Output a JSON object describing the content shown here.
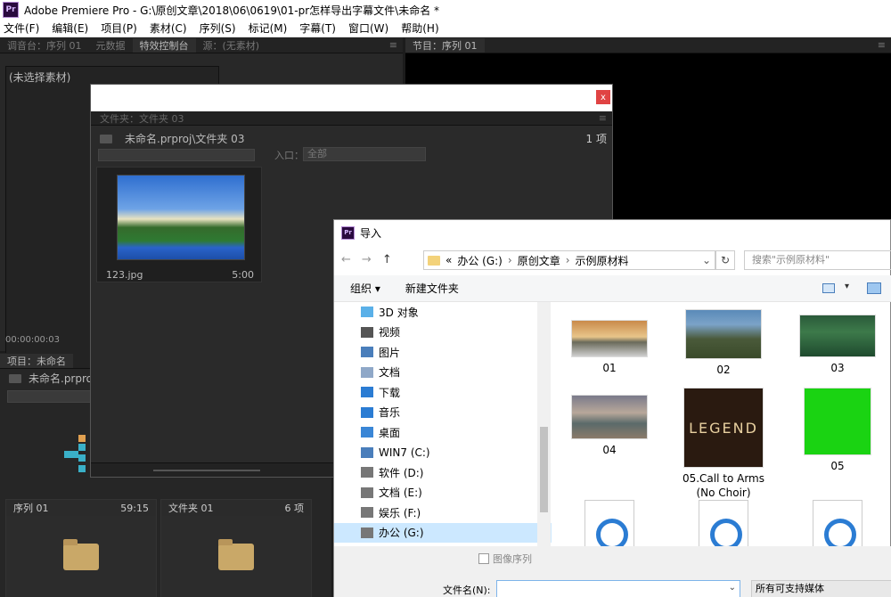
{
  "window": {
    "title": "Adobe Premiere Pro - G:\\原创文章\\2018\\06\\0619\\01-pr怎样导出字幕文件\\未命名 *",
    "logo_text": "Pr"
  },
  "menu": [
    "文件(F)",
    "编辑(E)",
    "项目(P)",
    "素材(C)",
    "序列(S)",
    "标记(M)",
    "字幕(T)",
    "窗口(W)",
    "帮助(H)"
  ],
  "left_panel": {
    "tabs": [
      "调音台：序列 01",
      "元数据",
      "特效控制台",
      "源：(无素材)"
    ],
    "active_tab": "特效控制台",
    "menu_icon": "≡",
    "no_clip": "(未选择素材)",
    "timecode": "00:00:00:03"
  },
  "program_panel": {
    "tab": "节目：序列 01",
    "menu_icon": "≡"
  },
  "project_panel": {
    "tab": "项目：未命名",
    "path": "未命名.prproj",
    "bins": [
      {
        "name": "序列 01",
        "info": "59:15"
      },
      {
        "name": "文件夹 01",
        "info": "6 项"
      }
    ]
  },
  "bin_window": {
    "close_label": "x",
    "tab": "文件夹：文件夹 03",
    "menu_icon": "≡",
    "path": "未命名.prproj\\文件夹 03",
    "count": "1 项",
    "entry_label": "入口：",
    "entry_value": "全部",
    "clip": {
      "name": "123.jpg",
      "duration": "5:00"
    }
  },
  "import_dialog": {
    "title": "导入",
    "logo_text": "Pr",
    "nav": {
      "back": "←",
      "forward": "→",
      "up": "↑"
    },
    "address": {
      "prefix": "«",
      "segments": [
        "办公 (G:)",
        "原创文章",
        "示例原材料"
      ],
      "sep": "›",
      "dropdown": "⌄",
      "refresh": "↻"
    },
    "search_placeholder": "搜索\"示例原材料\"",
    "toolbar": {
      "organize": "组织 ▾",
      "new_folder": "新建文件夹",
      "view_dropdown": "▾"
    },
    "nav_tree": [
      {
        "label": "3D 对象",
        "icon": "3d-objects-icon",
        "color": "#5ab0e8"
      },
      {
        "label": "视频",
        "icon": "video-icon",
        "color": "#555555"
      },
      {
        "label": "图片",
        "icon": "pictures-icon",
        "color": "#4a7ebb"
      },
      {
        "label": "文档",
        "icon": "documents-icon",
        "color": "#8fa8c8"
      },
      {
        "label": "下载",
        "icon": "downloads-icon",
        "color": "#2b7cd3"
      },
      {
        "label": "音乐",
        "icon": "music-icon",
        "color": "#2b7cd3"
      },
      {
        "label": "桌面",
        "icon": "desktop-icon",
        "color": "#3a86d6"
      },
      {
        "label": "WIN7 (C:)",
        "icon": "drive-icon",
        "color": "#4a7ebb"
      },
      {
        "label": "软件 (D:)",
        "icon": "drive-icon",
        "color": "#777777"
      },
      {
        "label": "文档 (E:)",
        "icon": "drive-icon",
        "color": "#777777"
      },
      {
        "label": "娱乐 (F:)",
        "icon": "drive-icon",
        "color": "#777777"
      },
      {
        "label": "办公 (G:)",
        "icon": "drive-icon",
        "color": "#777777",
        "selected": true
      }
    ],
    "files": [
      {
        "label": "01",
        "type": "image"
      },
      {
        "label": "02",
        "type": "image"
      },
      {
        "label": "03",
        "type": "image"
      },
      {
        "label": "04",
        "type": "image"
      },
      {
        "label": "05.Call to Arms (No Choir)",
        "type": "image",
        "thumb_text": "LEGEND"
      },
      {
        "label": "05",
        "type": "image"
      },
      {
        "label": "",
        "type": "media"
      },
      {
        "label": "",
        "type": "media"
      },
      {
        "label": "",
        "type": "media"
      }
    ],
    "image_sequence_label": "图像序列",
    "filename_label": "文件名(N):",
    "filename_value": "",
    "filename_dropdown": "⌄",
    "filetype_value": "所有可支持媒体"
  }
}
